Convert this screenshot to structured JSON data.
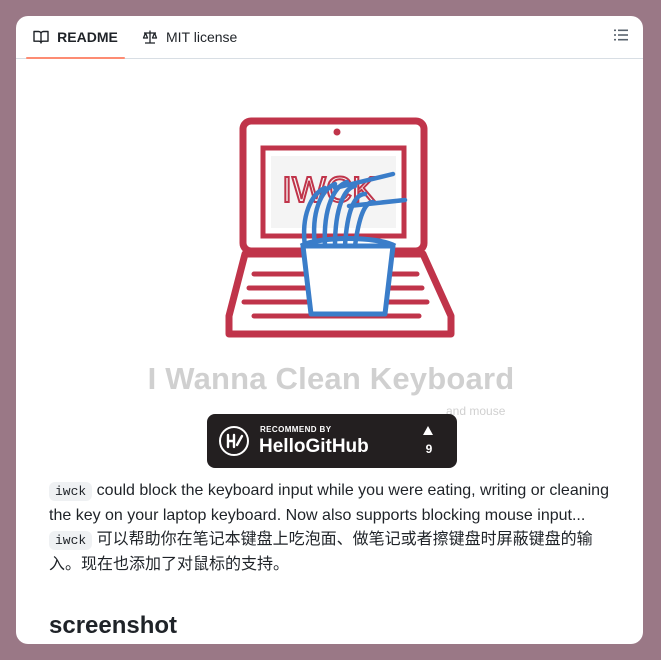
{
  "tabs": {
    "readme": "README",
    "license": "MIT license"
  },
  "hero": {
    "title": "I Wanna Clean Keyboard",
    "subtitle": "and mouse",
    "screen_text": "IWCK"
  },
  "badge": {
    "recommend": "RECOMMEND BY",
    "brand": "HelloGitHub",
    "count": "9"
  },
  "description": {
    "code": "iwck",
    "en": "could block the keyboard input while you were eating, writing or cleaning the key on your laptop keyboard. Now also supports blocking mouse input...",
    "zh_code": "iwck",
    "zh": "可以帮助你在笔记本键盘上吃泡面、做笔记或者擦键盘时屏蔽键盘的输入。现在也添加了对鼠标的支持。"
  },
  "section_heading": "screenshot",
  "colors": {
    "accent": "#fd8c73",
    "laptop": "#c0344a",
    "bowl": "#3a7dc9"
  }
}
